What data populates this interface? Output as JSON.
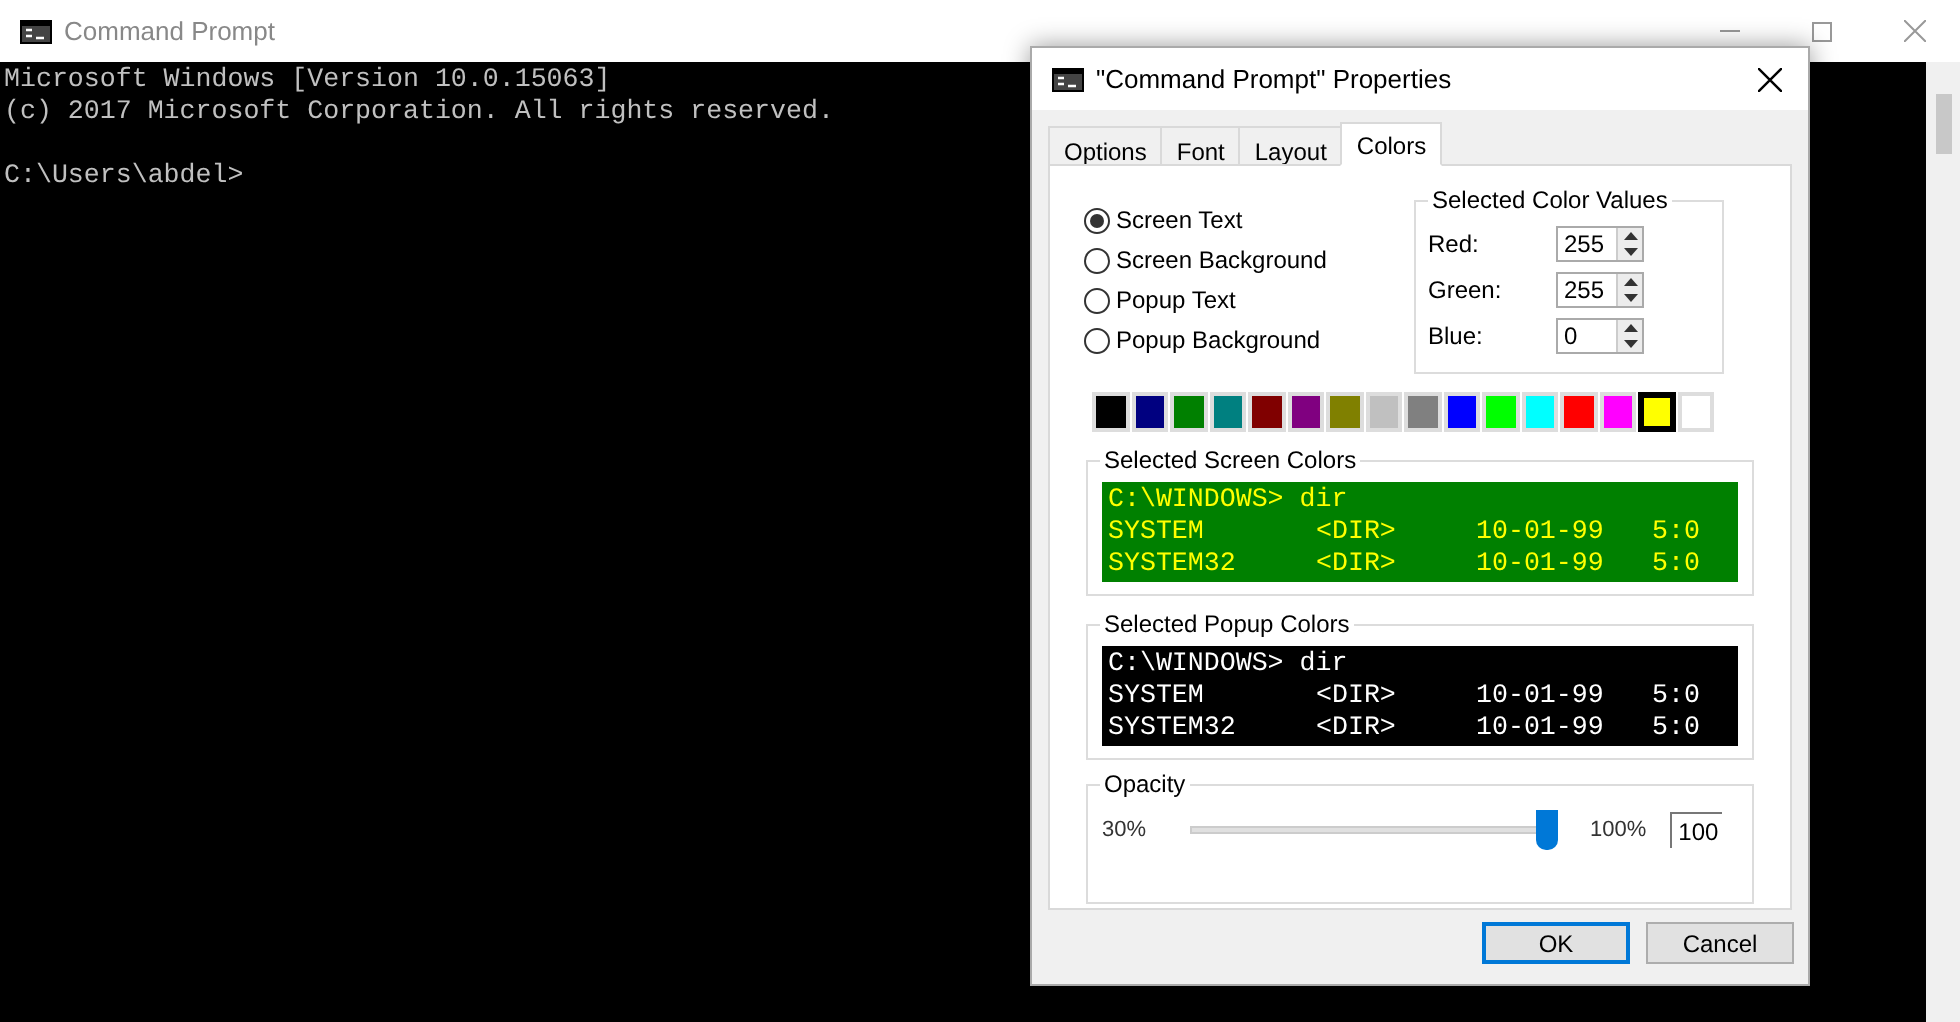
{
  "console": {
    "title": "Command Prompt",
    "lines": [
      "Microsoft Windows [Version 10.0.15063]",
      "(c) 2017 Microsoft Corporation. All rights reserved."
    ],
    "prompt": "C:\\Users\\abdel>"
  },
  "dialog": {
    "title": "\"Command Prompt\" Properties",
    "tabs": [
      {
        "label": "Options",
        "selected": false
      },
      {
        "label": "Font",
        "selected": false
      },
      {
        "label": "Layout",
        "selected": false
      },
      {
        "label": "Colors",
        "selected": true
      }
    ],
    "targets": [
      {
        "label": "Screen Text",
        "selected": true
      },
      {
        "label": "Screen Background",
        "selected": false
      },
      {
        "label": "Popup Text",
        "selected": false
      },
      {
        "label": "Popup Background",
        "selected": false
      }
    ],
    "color_values": {
      "title": "Selected Color Values",
      "fields": [
        {
          "label": "Red:",
          "value": "255"
        },
        {
          "label": "Green:",
          "value": "255"
        },
        {
          "label": "Blue:",
          "value": "0"
        }
      ]
    },
    "palette": [
      {
        "color": "#000000",
        "selected": false
      },
      {
        "color": "#000080",
        "selected": false
      },
      {
        "color": "#008000",
        "selected": false
      },
      {
        "color": "#008080",
        "selected": false
      },
      {
        "color": "#800000",
        "selected": false
      },
      {
        "color": "#800080",
        "selected": false
      },
      {
        "color": "#808000",
        "selected": false
      },
      {
        "color": "#c0c0c0",
        "selected": false
      },
      {
        "color": "#808080",
        "selected": false
      },
      {
        "color": "#0000ff",
        "selected": false
      },
      {
        "color": "#00ff00",
        "selected": false
      },
      {
        "color": "#00ffff",
        "selected": false
      },
      {
        "color": "#ff0000",
        "selected": false
      },
      {
        "color": "#ff00ff",
        "selected": false
      },
      {
        "color": "#ffff00",
        "selected": true
      },
      {
        "color": "#ffffff",
        "selected": false
      }
    ],
    "previews": [
      {
        "title": "Selected Screen Colors",
        "kind": "screen",
        "prompt": "C:\\WINDOWS> dir",
        "rows": [
          [
            "SYSTEM",
            "<DIR>",
            "10-01-99",
            "5:0"
          ],
          [
            "SYSTEM32",
            "<DIR>",
            "10-01-99",
            "5:0"
          ]
        ]
      },
      {
        "title": "Selected Popup Colors",
        "kind": "popup",
        "prompt": "C:\\WINDOWS> dir",
        "rows": [
          [
            "SYSTEM",
            "<DIR>",
            "10-01-99",
            "5:0"
          ],
          [
            "SYSTEM32",
            "<DIR>",
            "10-01-99",
            "5:0"
          ]
        ]
      }
    ],
    "opacity": {
      "title": "Opacity",
      "min_label": "30%",
      "max_label": "100%",
      "value": "100",
      "level": 1
    },
    "buttons": [
      {
        "label": "OK",
        "default": true
      },
      {
        "label": "Cancel",
        "default": false
      }
    ]
  }
}
